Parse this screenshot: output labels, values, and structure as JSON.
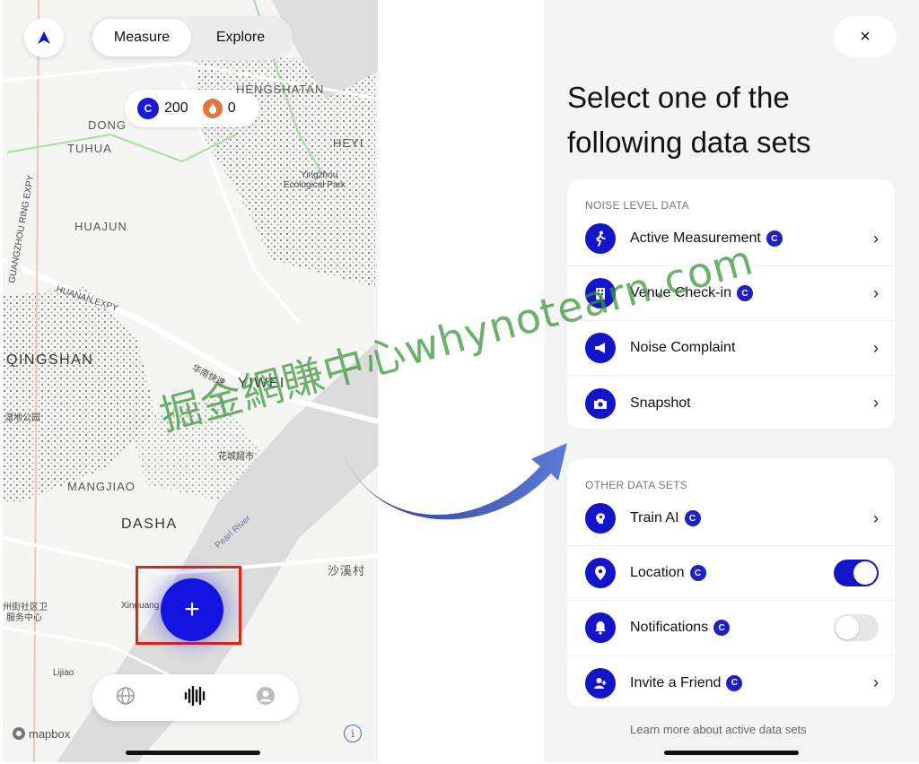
{
  "left": {
    "tabs": [
      {
        "label": "Measure",
        "active": true
      },
      {
        "label": "Explore",
        "active": false
      }
    ],
    "balance": {
      "coins": "200",
      "coin_symbol": "C",
      "fire": "0"
    },
    "map_labels": {
      "hengshatan": "HENGSHATAN",
      "dong": "DONG",
      "tuhua": "TUHUA",
      "huajun": "HUAJUN",
      "huanan": "HUANAN EXPY",
      "qingshan": "QINGSHAN",
      "yiwei": "YIWEI",
      "mangjiao": "MANGJIAO",
      "dasha": "DASHA",
      "pearl": "Pearl River",
      "eco1": "Yingzhou",
      "eco2": "Ecological Park",
      "xinguang": "Xinguang",
      "lijiao": "Lijiao",
      "ring": "GUANGZHOU RING EXPY",
      "heyi": "HEYI",
      "huacheng": "花城超市",
      "shaxi": "沙溪村",
      "south": "华南快速",
      "shidi": "湿地公园",
      "community1": "州街社区卫",
      "community2": "服务中心"
    },
    "fab_label": "+",
    "mapbox": "mapbox",
    "info": "i",
    "nav_icons": [
      "globe-icon",
      "soundwave-icon",
      "profile-icon"
    ]
  },
  "right": {
    "close": "×",
    "headline_1": "Select one of the",
    "headline_2": "following data sets",
    "section_1": {
      "title": "NOISE LEVEL DATA",
      "items": [
        {
          "label": "Active Measurement",
          "icon": "walking-icon",
          "control": "chevron"
        },
        {
          "label": "Venue Check-in",
          "icon": "building-icon",
          "control": "chevron"
        },
        {
          "label": "Noise Complaint",
          "icon": "megaphone-icon",
          "control": "chevron"
        },
        {
          "label": "Snapshot",
          "icon": "camera-icon",
          "control": "chevron"
        }
      ]
    },
    "section_2": {
      "title": "OTHER DATA SETS",
      "items": [
        {
          "label": "Train AI",
          "icon": "brain-icon",
          "control": "chevron"
        },
        {
          "label": "Location",
          "icon": "location-icon",
          "control": "toggle-on"
        },
        {
          "label": "Notifications",
          "icon": "bell-icon",
          "control": "toggle-off"
        },
        {
          "label": "Invite a Friend",
          "icon": "add-user-icon",
          "control": "chevron"
        }
      ]
    },
    "badge": "C",
    "chevron": "›",
    "learn_more": "Learn more about active data sets"
  },
  "watermark": "掘金網賺中心whynotearn.com",
  "colors": {
    "brand": "#1414c8",
    "fab": "#1414e0",
    "highlight": "#e2231a",
    "arrow": "#3b4fb8"
  }
}
